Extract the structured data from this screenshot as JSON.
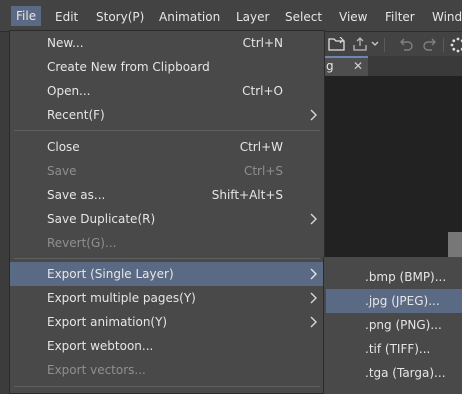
{
  "menubar": {
    "items": [
      "File",
      "Edit",
      "Story(P)",
      "Animation",
      "Layer",
      "Select",
      "View",
      "Filter",
      "Windo"
    ]
  },
  "background": {
    "tab_label": "g",
    "tab_close": "✕",
    "icons": [
      "open-folder-icon",
      "export-icon",
      "dropdown-caret-icon",
      "undo-icon",
      "redo-icon",
      "loading-icon"
    ]
  },
  "file_menu": {
    "items": [
      {
        "label": "New...",
        "shortcut": "Ctrl+N"
      },
      {
        "label": "Create New from Clipboard",
        "shortcut": ""
      },
      {
        "label": "Open...",
        "shortcut": "Ctrl+O"
      },
      {
        "label": "Recent(F)",
        "shortcut": ""
      },
      {
        "label": "Close",
        "shortcut": "Ctrl+W"
      },
      {
        "label": "Save",
        "shortcut": "Ctrl+S"
      },
      {
        "label": "Save as...",
        "shortcut": "Shift+Alt+S"
      },
      {
        "label": "Save Duplicate(R)",
        "shortcut": ""
      },
      {
        "label": "Revert(G)...",
        "shortcut": ""
      },
      {
        "label": "Export (Single Layer)",
        "shortcut": ""
      },
      {
        "label": "Export multiple pages(Y)",
        "shortcut": ""
      },
      {
        "label": "Export animation(Y)",
        "shortcut": ""
      },
      {
        "label": "Export webtoon...",
        "shortcut": ""
      },
      {
        "label": "Export vectors...",
        "shortcut": ""
      }
    ]
  },
  "export_submenu": {
    "items": [
      ".bmp (BMP)...",
      ".jpg (JPEG)...",
      ".png (PNG)...",
      ".tif (TIFF)...",
      ".tga (Targa)..."
    ]
  },
  "colors": {
    "highlight": "#5b6a84",
    "menu_bg": "#494949",
    "menubar_bg": "#434343",
    "disabled_text": "#8f8f8f"
  }
}
